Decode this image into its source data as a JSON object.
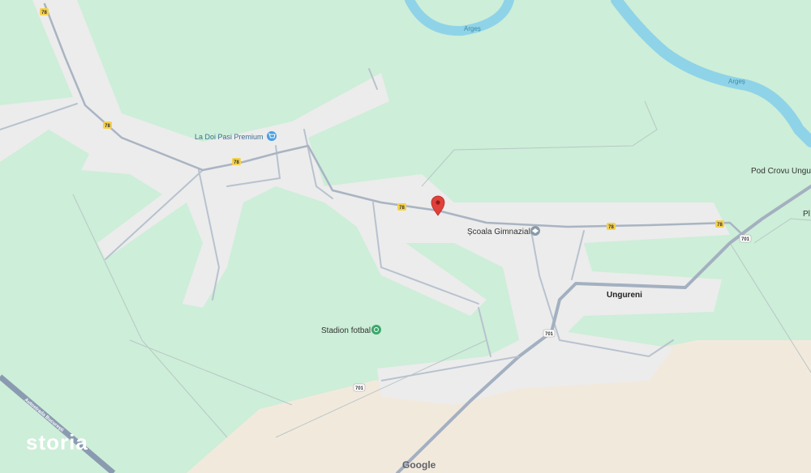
{
  "map": {
    "places": {
      "shop": "La Doi Pasi Premium",
      "school": "Școala Gimnazială",
      "village": "Ungureni",
      "stadium": "Stadion fotbal",
      "bridge": "Pod Crovu Ungureni",
      "edge_cut": "Pl"
    },
    "rivers": {
      "label_1": "Argeș",
      "label_2": "Argeș"
    },
    "road_shields": {
      "r78_a": "78",
      "r78_b": "78",
      "r78_c": "78",
      "r78_d": "78",
      "r78_e": "78",
      "r78_f": "78",
      "r701_a": "701",
      "r701_b": "701",
      "r701_c": "701"
    },
    "highway_label": "Autostrada București",
    "watermark": "storia",
    "attribution": "Google",
    "colors": {
      "land": "#cdeed8",
      "built_area": "#ececec",
      "sand": "#f2e9dd",
      "water": "#8fd3e8",
      "pin": "#e0413a",
      "road_edge": "#b8c2cf",
      "highway": "#8a9bb1"
    },
    "icons": {
      "shop": "shopping-cart-icon",
      "school": "school-icon",
      "stadium": "stadium-icon",
      "pin": "location-pin-icon"
    }
  }
}
